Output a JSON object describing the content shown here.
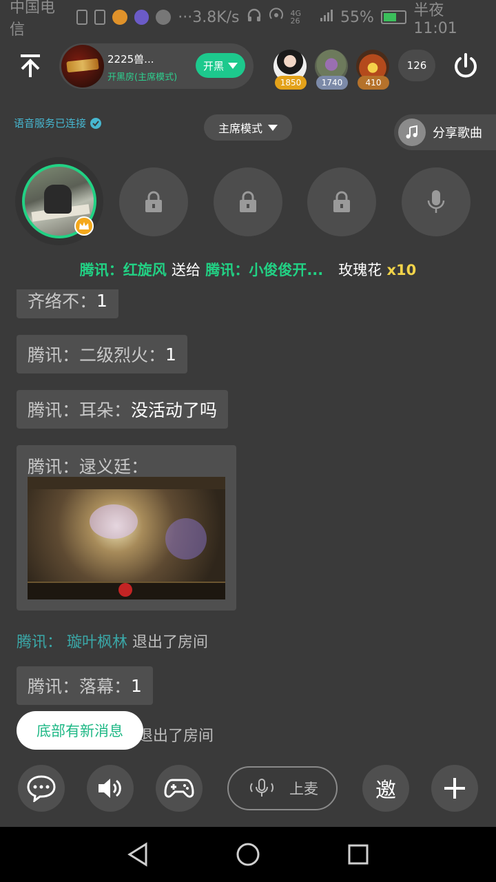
{
  "status_bar": {
    "carrier": "中国电信",
    "speed": "3.8K/s",
    "network": "4G 26",
    "battery": "55%",
    "time": "半夜11:01"
  },
  "header": {
    "room_name": "2225兽...",
    "room_subtitle": "开黑房(主席模式)",
    "mode_button": "开黑",
    "audience": [
      {
        "score": "1850",
        "badge_color": "#e3a21a"
      },
      {
        "score": "1740",
        "badge_color": "#7c8aa8"
      },
      {
        "score": "410",
        "badge_color": "#b5722b"
      }
    ],
    "online_count": "126"
  },
  "room_bar": {
    "voice_status": "语音服务已连接",
    "host_mode": "主席模式",
    "share_song": "分享歌曲"
  },
  "seats": [
    {
      "state": "host"
    },
    {
      "state": "locked"
    },
    {
      "state": "locked"
    },
    {
      "state": "locked"
    },
    {
      "state": "mic"
    }
  ],
  "gift_banner": {
    "sender": "腾讯：红旋风",
    "action": "送给",
    "receiver": "腾讯：小俊俊开...",
    "gift": "玫瑰花",
    "count": "x10"
  },
  "chat": {
    "messages": [
      {
        "name": "齐络不：",
        "text": "1"
      },
      {
        "name": "腾讯：二级烈火：",
        "text": "1"
      },
      {
        "name": "腾讯：耳朵：",
        "text": "没活动了吗"
      },
      {
        "name": "腾讯：逯义廷："
      },
      {
        "name": "腾讯：",
        "who": "璇叶枫林",
        "text": "退出了房间"
      },
      {
        "name": "腾讯：落幕：",
        "text": "1"
      },
      {
        "text": "退出了房间"
      }
    ],
    "new_message_toast": "底部有新消息"
  },
  "bottom_bar": {
    "mic_label": "上麦",
    "invite_label": "邀"
  },
  "colors": {
    "accent_green": "#22d184",
    "background": "#3a3a3a"
  }
}
